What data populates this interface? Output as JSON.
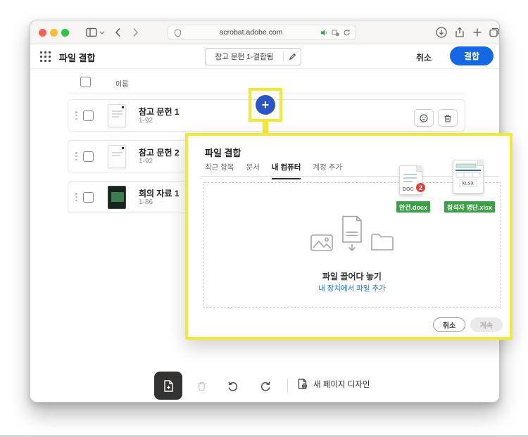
{
  "browser": {
    "url": "acrobat.adobe.com",
    "traffic_colors": {
      "close": "#ff5f57",
      "min": "#febc2e",
      "max": "#28c840"
    }
  },
  "header": {
    "app_title": "파일 결합",
    "filename_value": "참고 문헌 1-결합됨",
    "cancel_label": "취소",
    "combine_label": "결합",
    "accent_color": "#1568e3"
  },
  "list": {
    "name_header": "이름",
    "rows": [
      {
        "name": "참고 문헌 1",
        "pages": "1-92"
      },
      {
        "name": "참고 문헌 2",
        "pages": "1-92"
      },
      {
        "name": "회의 자료 1",
        "pages": "1-86"
      }
    ]
  },
  "plus": {
    "glyph": "+",
    "color": "#2a55c4",
    "highlight": "#f2e935"
  },
  "popup": {
    "title": "파일 결합",
    "tabs": [
      {
        "label": "최근 항목"
      },
      {
        "label": "문서"
      },
      {
        "label": "내 컴퓨터"
      },
      {
        "label": "계정 추가"
      }
    ],
    "dropzone": {
      "title": "파일 끌어다 놓기",
      "link": "내 장치에서 파일 추가",
      "link_color": "#1473e6"
    },
    "files": [
      {
        "label": "안건.docx",
        "type_text": "DOC",
        "badge": "2"
      },
      {
        "label": "참석자 명단.xlsx",
        "type_text": "XLSX"
      }
    ],
    "label_bg": "#3ea046",
    "badge_bg": "#e2403a",
    "cancel_label": "취소",
    "continue_label": "계속"
  },
  "toolbar": {
    "new_page_design": "새 페이지 디자인"
  }
}
